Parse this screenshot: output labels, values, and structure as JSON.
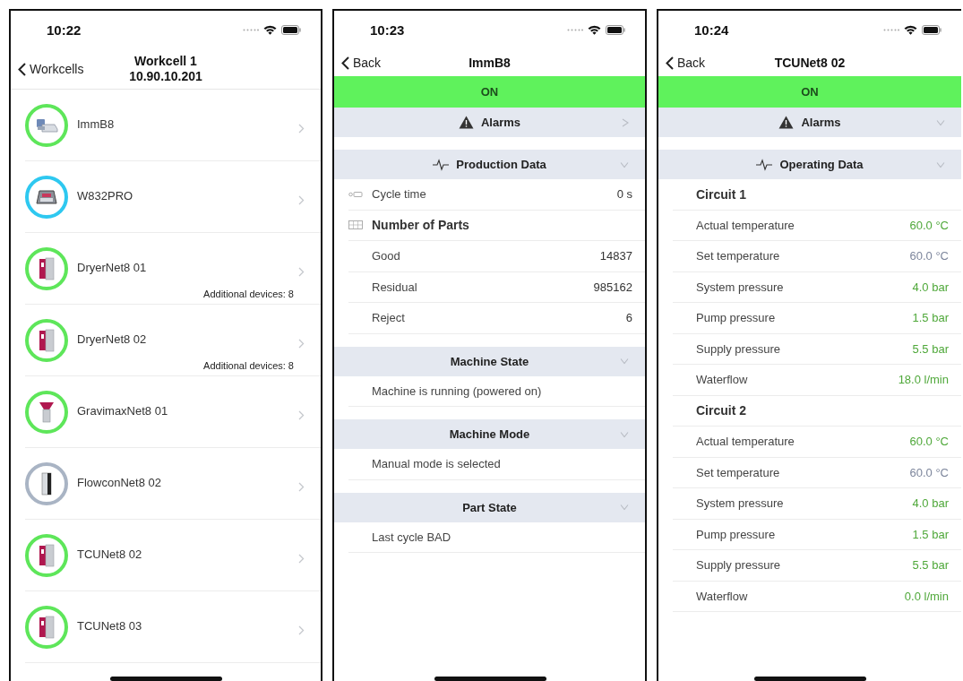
{
  "screens": [
    {
      "kind": "device_list",
      "time": "10:22",
      "back": "Workcells",
      "title": "Workcell 1",
      "subtitle": "10.90.10.201",
      "devices": [
        {
          "name": "ImmB8",
          "color": "#5ee65a"
        },
        {
          "name": "W832PRO",
          "color": "#2ec8f0"
        },
        {
          "name": "DryerNet8 01",
          "color": "#5ee65a",
          "note": "Additional devices: 8"
        },
        {
          "name": "DryerNet8 02",
          "color": "#5ee65a",
          "note": "Additional devices: 8"
        },
        {
          "name": "GravimaxNet8 01",
          "color": "#5ee65a"
        },
        {
          "name": "FlowconNet8 02",
          "color": "#a9b4c4"
        },
        {
          "name": "TCUNet8 02",
          "color": "#5ee65a"
        },
        {
          "name": "TCUNet8 03",
          "color": "#5ee65a"
        }
      ]
    },
    {
      "kind": "detail",
      "time": "10:23",
      "back": "Back",
      "title": "ImmB8",
      "status": {
        "label": "ON",
        "color": "#5ff25c"
      },
      "sections": [
        {
          "title": "Alarms",
          "expanded": false
        },
        {
          "title": "Production Data",
          "expanded": true,
          "rows": [
            {
              "kind": "value",
              "label": "Cycle time",
              "value": "0 s"
            },
            {
              "kind": "heading",
              "label": "Number of Parts"
            },
            {
              "kind": "value",
              "label": "Good",
              "value": "14837"
            },
            {
              "kind": "value",
              "label": "Residual",
              "value": "985162"
            },
            {
              "kind": "value",
              "label": "Reject",
              "value": "6"
            }
          ]
        },
        {
          "title": "Machine State",
          "expanded": true,
          "rows": [
            {
              "kind": "text",
              "label": "Machine is running (powered on)"
            }
          ]
        },
        {
          "title": "Machine Mode",
          "expanded": true,
          "rows": [
            {
              "kind": "text",
              "label": "Manual mode is selected"
            }
          ]
        },
        {
          "title": "Part State",
          "expanded": true,
          "rows": [
            {
              "kind": "text",
              "label": "Last cycle BAD"
            }
          ]
        }
      ]
    },
    {
      "kind": "detail",
      "time": "10:24",
      "back": "Back",
      "title": "TCUNet8 02",
      "status": {
        "label": "ON",
        "color": "#5ff25c"
      },
      "sections": [
        {
          "title": "Alarms",
          "expanded": true
        },
        {
          "title": "Operating Data",
          "expanded": true,
          "rows": [
            {
              "kind": "heading",
              "label": "Circuit 1"
            },
            {
              "kind": "value",
              "label": "Actual temperature",
              "value": "60.0 °C",
              "color": "#4fa83a"
            },
            {
              "kind": "value",
              "label": "Set temperature",
              "value": "60.0 °C",
              "color": "#7d869c"
            },
            {
              "kind": "value",
              "label": "System pressure",
              "value": "4.0 bar",
              "color": "#4fa83a"
            },
            {
              "kind": "value",
              "label": "Pump pressure",
              "value": "1.5 bar",
              "color": "#4fa83a"
            },
            {
              "kind": "value",
              "label": "Supply pressure",
              "value": "5.5 bar",
              "color": "#4fa83a"
            },
            {
              "kind": "value",
              "label": "Waterflow",
              "value": "18.0 l/min",
              "color": "#4fa83a"
            },
            {
              "kind": "heading",
              "label": "Circuit 2"
            },
            {
              "kind": "value",
              "label": "Actual temperature",
              "value": "60.0 °C",
              "color": "#4fa83a"
            },
            {
              "kind": "value",
              "label": "Set temperature",
              "value": "60.0 °C",
              "color": "#7d869c"
            },
            {
              "kind": "value",
              "label": "System pressure",
              "value": "4.0 bar",
              "color": "#4fa83a"
            },
            {
              "kind": "value",
              "label": "Pump pressure",
              "value": "1.5 bar",
              "color": "#4fa83a"
            },
            {
              "kind": "value",
              "label": "Supply pressure",
              "value": "5.5 bar",
              "color": "#4fa83a"
            },
            {
              "kind": "value",
              "label": "Waterflow",
              "value": "0.0 l/min",
              "color": "#4fa83a"
            }
          ]
        }
      ]
    }
  ]
}
